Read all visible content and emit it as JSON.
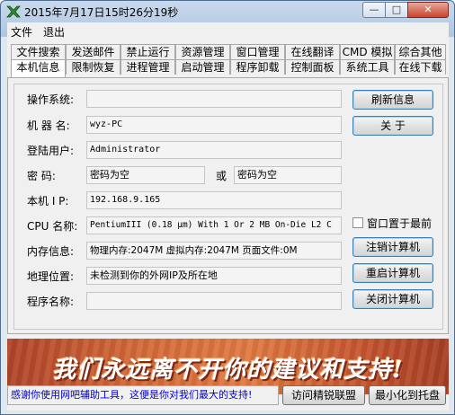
{
  "window": {
    "title": "2015年7月17日15时26分19秒",
    "controls": {
      "minimize": "—",
      "maximize": "□",
      "close": "✕"
    }
  },
  "menu": [
    "文件",
    "退出"
  ],
  "tabs_row1": [
    "文件搜索",
    "发送邮件",
    "禁止运行",
    "资源管理",
    "窗口管理",
    "在线翻译",
    "CMD 模拟",
    "综合其他"
  ],
  "tabs_row2": [
    "本机信息",
    "限制恢复",
    "进程管理",
    "启动管理",
    "程序卸载",
    "控制面板",
    "系统工具",
    "在线下载"
  ],
  "info": {
    "os_label": "操作系统:",
    "os_value": "",
    "machine_label": "机 器 名:",
    "machine_value": "wyz-PC",
    "user_label": "登陆用户:",
    "user_value": "Administrator",
    "password_label": "密    码:",
    "password_value": "密码为空",
    "or_label": "或",
    "password_value2": "密码为空",
    "ip_label": "本机 I P:",
    "ip_value": "192.168.9.165",
    "cpu_label": "CPU 名称:",
    "cpu_value": "PentiumIII (0.18 μm) With 1 Or 2 MB On-Die L2 C",
    "memory_label": "内存信息:",
    "memory_value": "物理内存:2047M  虚拟内存:2047M  页面文件:0M",
    "location_label": "地理位置:",
    "location_value": "未检测到你的外网IP及所在地",
    "program_label": "程序名称:",
    "program_value": ""
  },
  "buttons": {
    "refresh": "刷新信息",
    "about": "关    于",
    "topmost_checkbox": "窗口置于最前",
    "topmost_checked": false,
    "logoff": "注销计算机",
    "restart": "重启计算机",
    "shutdown": "关闭计算机"
  },
  "banner": {
    "text": "我们永远离不开你的建议和支持!",
    "colors": {
      "left": "#b0442a",
      "mid": "#e07a42",
      "text": "#ffffff"
    }
  },
  "footer": {
    "status_text": "感谢你使用网吧辅助工具，这便是你对我们最大的支持!",
    "visit_button": "访问精锐联盟",
    "tray_button": "最小化到托盘",
    "status_color": "#0000cc"
  }
}
